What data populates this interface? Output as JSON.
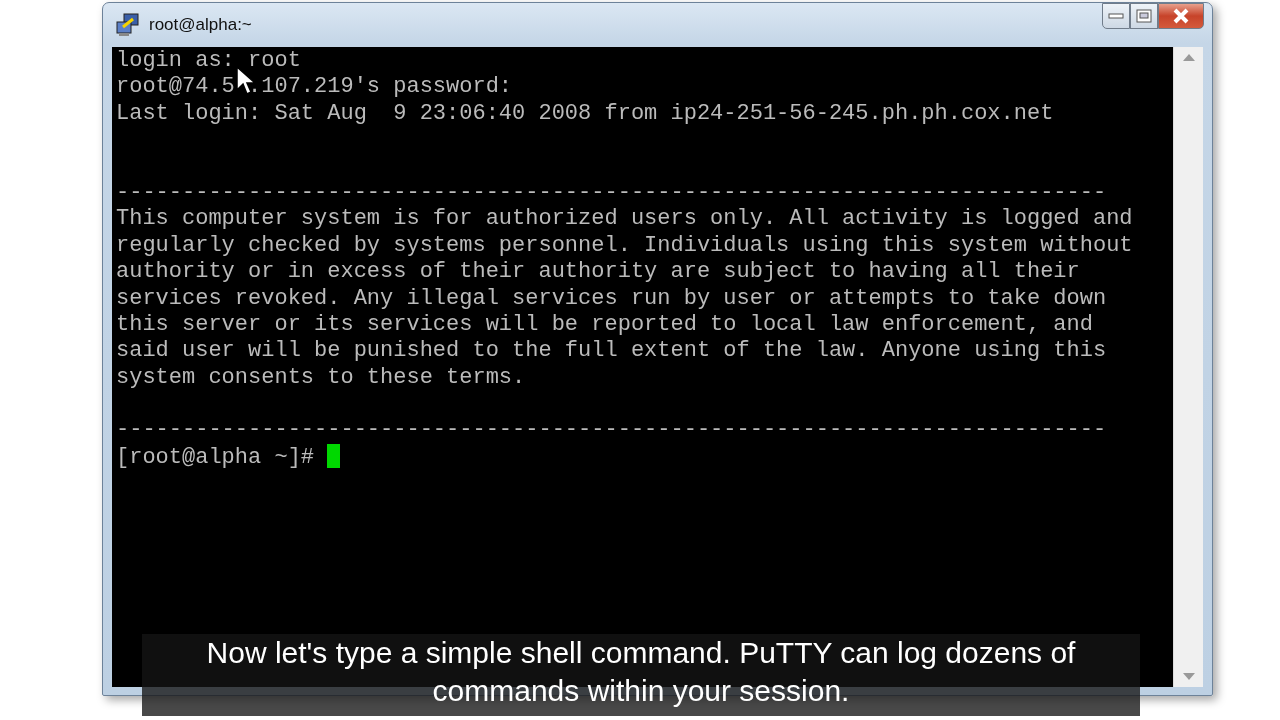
{
  "window": {
    "title": "root@alpha:~"
  },
  "terminal": {
    "lines": [
      {
        "kind": "text",
        "text": "login as: root"
      },
      {
        "kind": "pointer",
        "before": "root@74.5",
        "after": ".107.219's password:"
      },
      {
        "kind": "text",
        "text": "Last login: Sat Aug  9 23:06:40 2008 from ip24-251-56-245.ph.ph.cox.net"
      },
      {
        "kind": "blank"
      },
      {
        "kind": "blank"
      },
      {
        "kind": "text",
        "text": "---------------------------------------------------------------------------"
      },
      {
        "kind": "text",
        "text": "This computer system is for authorized users only. All activity is logged and"
      },
      {
        "kind": "text",
        "text": "regularly checked by systems personnel. Individuals using this system without"
      },
      {
        "kind": "text",
        "text": "authority or in excess of their authority are subject to having all their"
      },
      {
        "kind": "text",
        "text": "services revoked. Any illegal services run by user or attempts to take down"
      },
      {
        "kind": "text",
        "text": "this server or its services will be reported to local law enforcement, and"
      },
      {
        "kind": "text",
        "text": "said user will be punished to the full extent of the law. Anyone using this"
      },
      {
        "kind": "text",
        "text": "system consents to these terms."
      },
      {
        "kind": "blank"
      },
      {
        "kind": "text",
        "text": "---------------------------------------------------------------------------"
      },
      {
        "kind": "prompt",
        "text": "[root@alpha ~]#"
      }
    ]
  },
  "caption": {
    "text": "Now let's type a simple shell command. PuTTY can log dozens of commands within your session."
  }
}
